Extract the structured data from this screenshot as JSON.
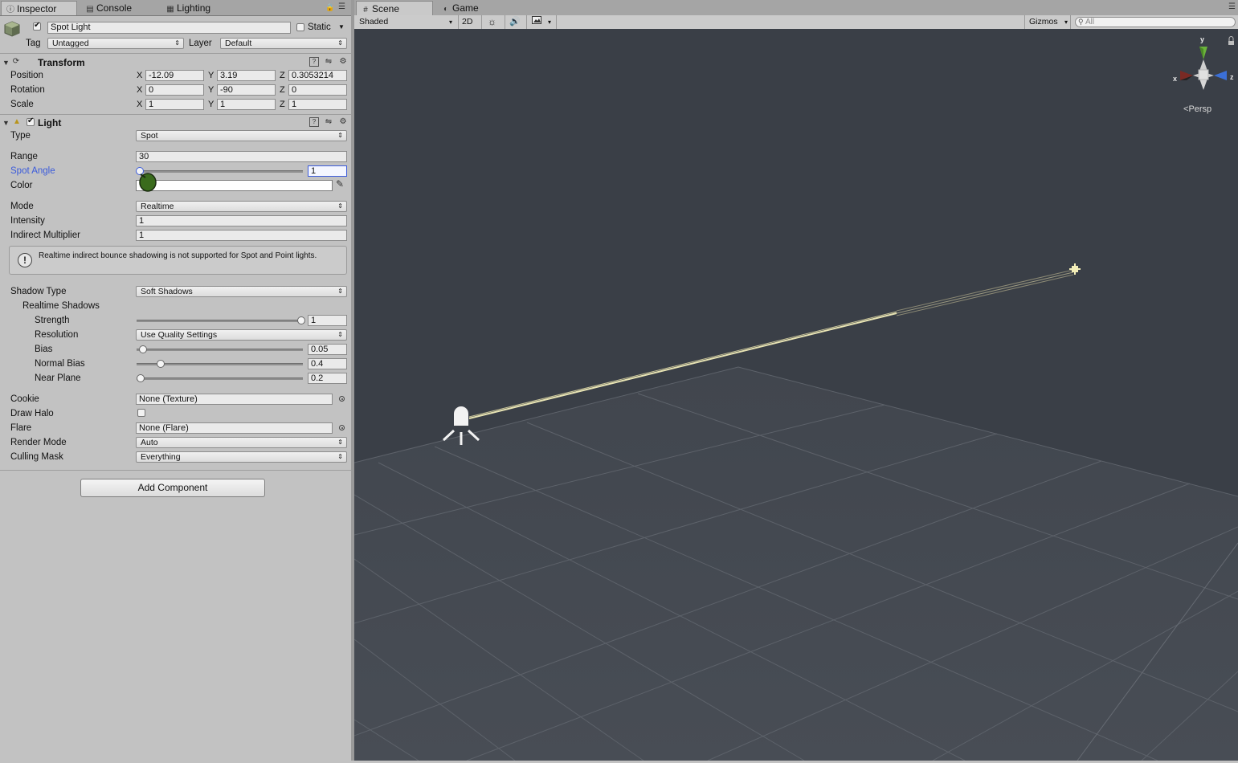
{
  "inspector_tabs": [
    {
      "label": "Inspector",
      "icon": "info-icon"
    },
    {
      "label": "Console",
      "icon": "console-icon"
    },
    {
      "label": "Lighting",
      "icon": "lighting-icon"
    }
  ],
  "object": {
    "name": "Spot Light",
    "active": true,
    "static_label": "Static",
    "static": false,
    "tag_label": "Tag",
    "tag": "Untagged",
    "layer_label": "Layer",
    "layer": "Default"
  },
  "transform": {
    "title": "Transform",
    "rows": [
      {
        "label": "Position",
        "x": "-12.09",
        "y": "3.19",
        "z": "0.3053214"
      },
      {
        "label": "Rotation",
        "x": "0",
        "y": "-90",
        "z": "0"
      },
      {
        "label": "Scale",
        "x": "1",
        "y": "1",
        "z": "1"
      }
    ],
    "axis_x": "X",
    "axis_y": "Y",
    "axis_z": "Z"
  },
  "light": {
    "title": "Light",
    "enabled": true,
    "type_label": "Type",
    "type": "Spot",
    "range_label": "Range",
    "range": "30",
    "spot_angle_label": "Spot Angle",
    "spot_angle": "1",
    "color_label": "Color",
    "color_value": "#ffffff",
    "mode_label": "Mode",
    "mode": "Realtime",
    "intensity_label": "Intensity",
    "intensity": "1",
    "indirect_label": "Indirect Multiplier",
    "indirect": "1",
    "help_text": "Realtime indirect bounce shadowing is not supported for Spot and Point lights.",
    "help_icon": "!",
    "shadow_type_label": "Shadow Type",
    "shadow_type": "Soft Shadows",
    "realtime_shadows_label": "Realtime Shadows",
    "strength_label": "Strength",
    "strength": "1",
    "resolution_label": "Resolution",
    "resolution": "Use Quality Settings",
    "bias_label": "Bias",
    "bias": "0.05",
    "normal_bias_label": "Normal Bias",
    "normal_bias": "0.4",
    "near_plane_label": "Near Plane",
    "near_plane": "0.2",
    "cookie_label": "Cookie",
    "cookie": "None (Texture)",
    "draw_halo_label": "Draw Halo",
    "draw_halo": false,
    "flare_label": "Flare",
    "flare": "None (Flare)",
    "render_mode_label": "Render Mode",
    "render_mode": "Auto",
    "culling_mask_label": "Culling Mask",
    "culling_mask": "Everything"
  },
  "add_component_label": "Add Component",
  "scene_tabs": [
    {
      "label": "Scene",
      "icon": "scene-icon"
    },
    {
      "label": "Game",
      "icon": "game-icon"
    }
  ],
  "scene_toolbar": {
    "shading": "Shaded",
    "mode_2d": "2D",
    "gizmos": "Gizmos",
    "search_placeholder": "All"
  },
  "scene_gizmo": {
    "x": "x",
    "y": "y",
    "z": "z",
    "projection": "Persp"
  },
  "colors": {
    "scene_bg": "#3a3f47",
    "grid": "#5d626a",
    "accent_label": "#3b5bdb",
    "gizmo_y": "#6bb33c",
    "gizmo_z": "#3b6fd6",
    "gizmo_x": "#c43a2e",
    "light_ray": "#e8e4b4"
  }
}
